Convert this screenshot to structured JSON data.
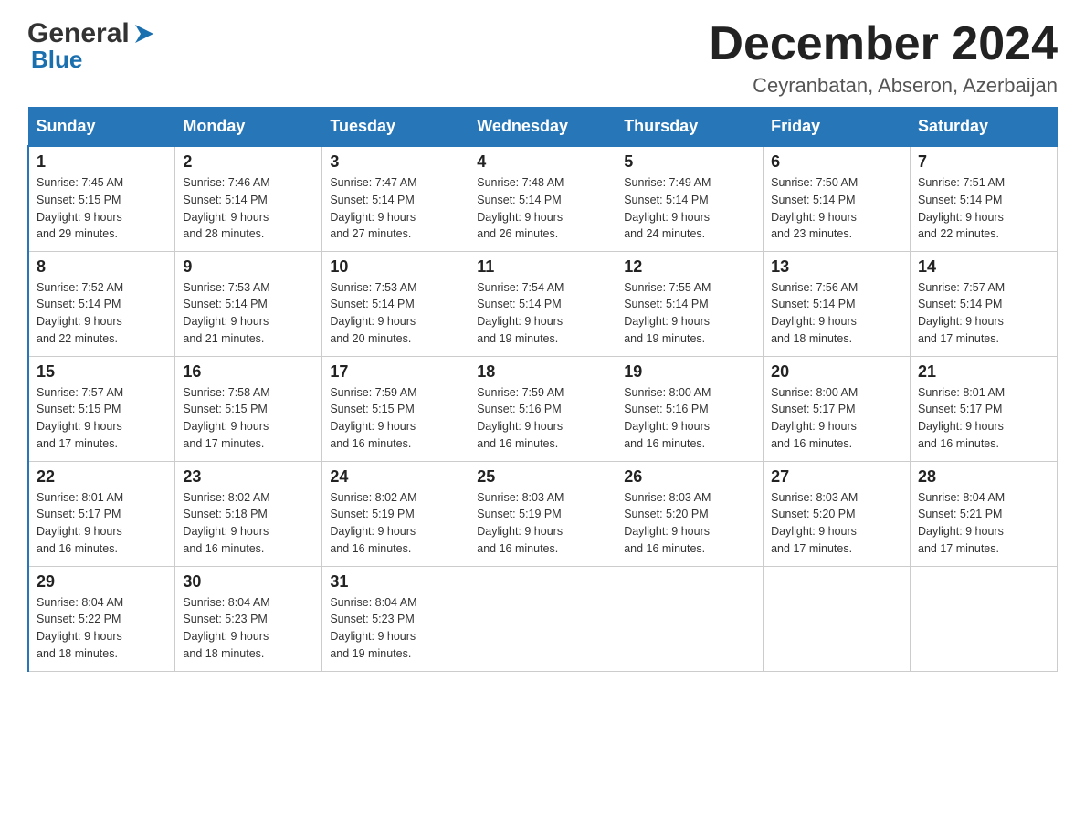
{
  "header": {
    "logo_general": "General",
    "logo_blue": "Blue",
    "month_title": "December 2024",
    "location": "Ceyranbatan, Abseron, Azerbaijan"
  },
  "days_of_week": [
    "Sunday",
    "Monday",
    "Tuesday",
    "Wednesday",
    "Thursday",
    "Friday",
    "Saturday"
  ],
  "weeks": [
    [
      {
        "day": "1",
        "sunrise": "7:45 AM",
        "sunset": "5:15 PM",
        "daylight": "9 hours and 29 minutes."
      },
      {
        "day": "2",
        "sunrise": "7:46 AM",
        "sunset": "5:14 PM",
        "daylight": "9 hours and 28 minutes."
      },
      {
        "day": "3",
        "sunrise": "7:47 AM",
        "sunset": "5:14 PM",
        "daylight": "9 hours and 27 minutes."
      },
      {
        "day": "4",
        "sunrise": "7:48 AM",
        "sunset": "5:14 PM",
        "daylight": "9 hours and 26 minutes."
      },
      {
        "day": "5",
        "sunrise": "7:49 AM",
        "sunset": "5:14 PM",
        "daylight": "9 hours and 24 minutes."
      },
      {
        "day": "6",
        "sunrise": "7:50 AM",
        "sunset": "5:14 PM",
        "daylight": "9 hours and 23 minutes."
      },
      {
        "day": "7",
        "sunrise": "7:51 AM",
        "sunset": "5:14 PM",
        "daylight": "9 hours and 22 minutes."
      }
    ],
    [
      {
        "day": "8",
        "sunrise": "7:52 AM",
        "sunset": "5:14 PM",
        "daylight": "9 hours and 22 minutes."
      },
      {
        "day": "9",
        "sunrise": "7:53 AM",
        "sunset": "5:14 PM",
        "daylight": "9 hours and 21 minutes."
      },
      {
        "day": "10",
        "sunrise": "7:53 AM",
        "sunset": "5:14 PM",
        "daylight": "9 hours and 20 minutes."
      },
      {
        "day": "11",
        "sunrise": "7:54 AM",
        "sunset": "5:14 PM",
        "daylight": "9 hours and 19 minutes."
      },
      {
        "day": "12",
        "sunrise": "7:55 AM",
        "sunset": "5:14 PM",
        "daylight": "9 hours and 19 minutes."
      },
      {
        "day": "13",
        "sunrise": "7:56 AM",
        "sunset": "5:14 PM",
        "daylight": "9 hours and 18 minutes."
      },
      {
        "day": "14",
        "sunrise": "7:57 AM",
        "sunset": "5:14 PM",
        "daylight": "9 hours and 17 minutes."
      }
    ],
    [
      {
        "day": "15",
        "sunrise": "7:57 AM",
        "sunset": "5:15 PM",
        "daylight": "9 hours and 17 minutes."
      },
      {
        "day": "16",
        "sunrise": "7:58 AM",
        "sunset": "5:15 PM",
        "daylight": "9 hours and 17 minutes."
      },
      {
        "day": "17",
        "sunrise": "7:59 AM",
        "sunset": "5:15 PM",
        "daylight": "9 hours and 16 minutes."
      },
      {
        "day": "18",
        "sunrise": "7:59 AM",
        "sunset": "5:16 PM",
        "daylight": "9 hours and 16 minutes."
      },
      {
        "day": "19",
        "sunrise": "8:00 AM",
        "sunset": "5:16 PM",
        "daylight": "9 hours and 16 minutes."
      },
      {
        "day": "20",
        "sunrise": "8:00 AM",
        "sunset": "5:17 PM",
        "daylight": "9 hours and 16 minutes."
      },
      {
        "day": "21",
        "sunrise": "8:01 AM",
        "sunset": "5:17 PM",
        "daylight": "9 hours and 16 minutes."
      }
    ],
    [
      {
        "day": "22",
        "sunrise": "8:01 AM",
        "sunset": "5:17 PM",
        "daylight": "9 hours and 16 minutes."
      },
      {
        "day": "23",
        "sunrise": "8:02 AM",
        "sunset": "5:18 PM",
        "daylight": "9 hours and 16 minutes."
      },
      {
        "day": "24",
        "sunrise": "8:02 AM",
        "sunset": "5:19 PM",
        "daylight": "9 hours and 16 minutes."
      },
      {
        "day": "25",
        "sunrise": "8:03 AM",
        "sunset": "5:19 PM",
        "daylight": "9 hours and 16 minutes."
      },
      {
        "day": "26",
        "sunrise": "8:03 AM",
        "sunset": "5:20 PM",
        "daylight": "9 hours and 16 minutes."
      },
      {
        "day": "27",
        "sunrise": "8:03 AM",
        "sunset": "5:20 PM",
        "daylight": "9 hours and 17 minutes."
      },
      {
        "day": "28",
        "sunrise": "8:04 AM",
        "sunset": "5:21 PM",
        "daylight": "9 hours and 17 minutes."
      }
    ],
    [
      {
        "day": "29",
        "sunrise": "8:04 AM",
        "sunset": "5:22 PM",
        "daylight": "9 hours and 18 minutes."
      },
      {
        "day": "30",
        "sunrise": "8:04 AM",
        "sunset": "5:23 PM",
        "daylight": "9 hours and 18 minutes."
      },
      {
        "day": "31",
        "sunrise": "8:04 AM",
        "sunset": "5:23 PM",
        "daylight": "9 hours and 19 minutes."
      },
      null,
      null,
      null,
      null
    ]
  ],
  "labels": {
    "sunrise": "Sunrise: ",
    "sunset": "Sunset: ",
    "daylight": "Daylight: "
  }
}
